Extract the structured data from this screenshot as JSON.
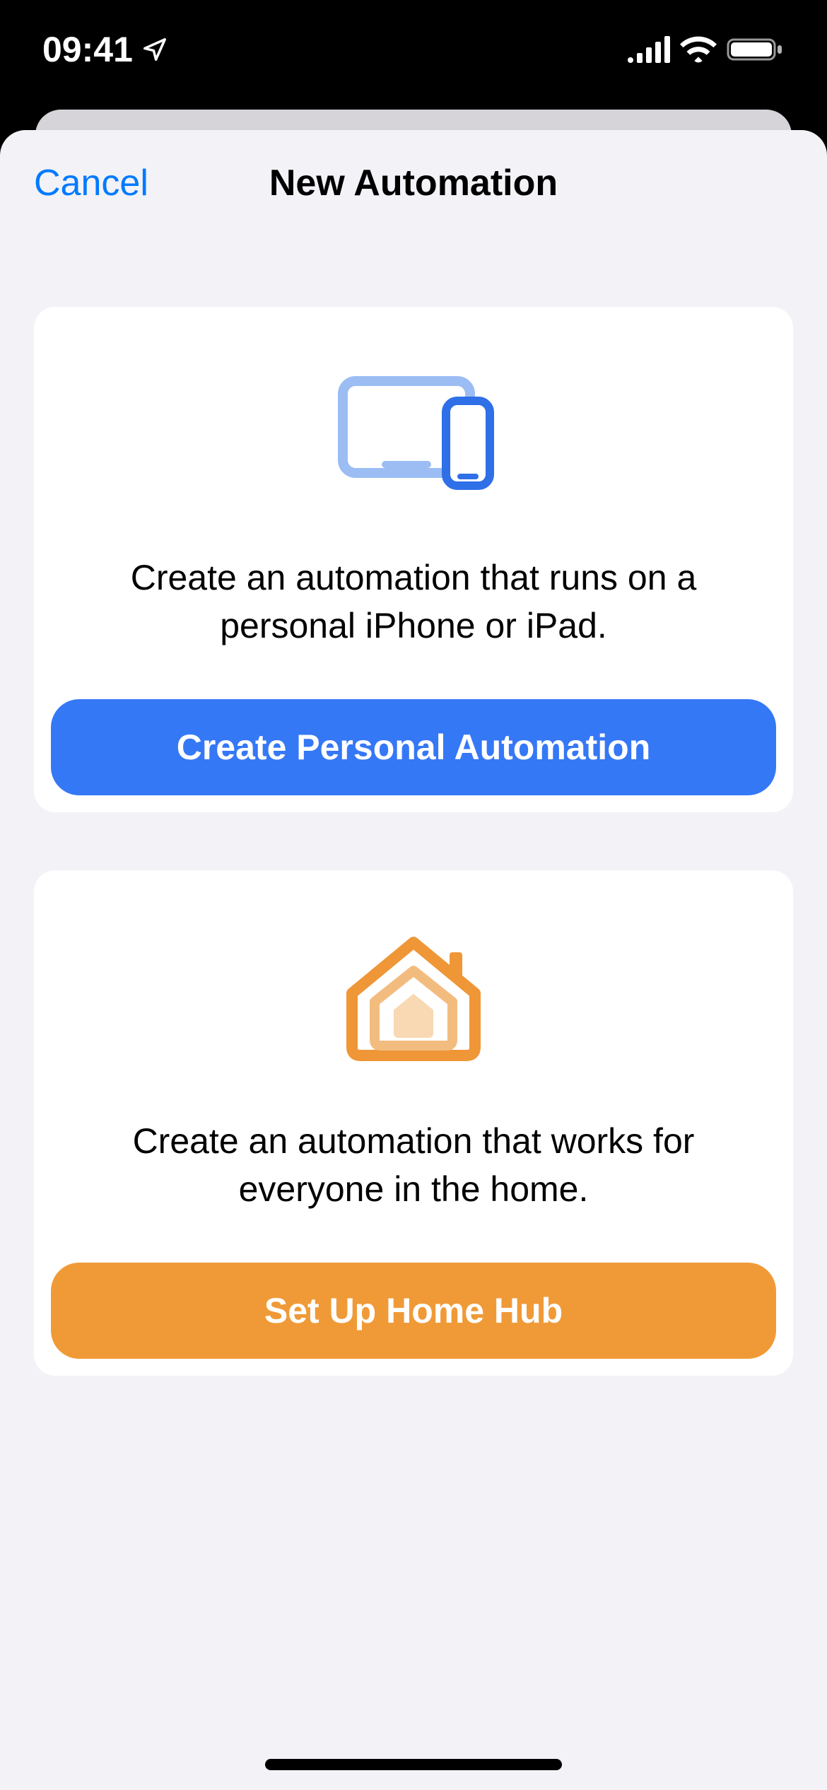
{
  "status": {
    "time": "09:41"
  },
  "nav": {
    "cancel": "Cancel",
    "title": "New Automation"
  },
  "cards": {
    "personal": {
      "description": "Create an automation that runs on a personal iPhone or iPad.",
      "button": "Create Personal Automation"
    },
    "home": {
      "description": "Create an automation that works for everyone in the home.",
      "button": "Set Up Home Hub"
    }
  },
  "colors": {
    "accent_blue": "#3578f6",
    "accent_orange": "#f09a37",
    "sheet_bg": "#f2f2f7",
    "link": "#007aff"
  }
}
